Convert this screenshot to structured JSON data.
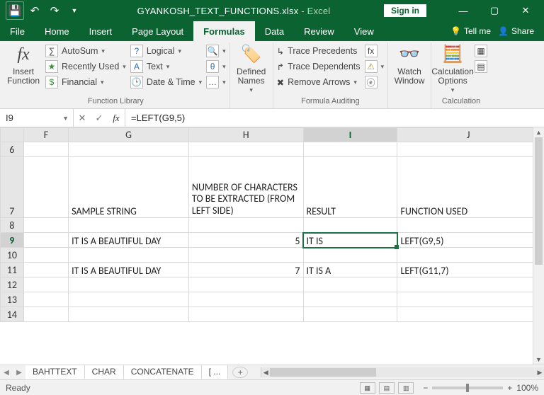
{
  "titlebar": {
    "doc": "GYANKOSH_TEXT_FUNCTIONS.xlsx",
    "app": "Excel",
    "signin": "Sign in"
  },
  "tabs": {
    "file": "File",
    "home": "Home",
    "insert": "Insert",
    "page_layout": "Page Layout",
    "formulas": "Formulas",
    "data": "Data",
    "review": "Review",
    "view": "View",
    "tellme": "Tell me",
    "share": "Share"
  },
  "ribbon": {
    "insert_function": "Insert Function",
    "autosum": "AutoSum",
    "recently_used": "Recently Used",
    "financial": "Financial",
    "logical": "Logical",
    "text": "Text",
    "date_time": "Date & Time",
    "defined_names": "Defined Names",
    "trace_prec": "Trace Precedents",
    "trace_dep": "Trace Dependents",
    "remove_arrows": "Remove Arrows",
    "watch_window": "Watch Window",
    "calc_options": "Calculation Options",
    "group_funclib": "Function Library",
    "group_audit": "Formula Auditing",
    "group_calc": "Calculation"
  },
  "formula_bar": {
    "cell_ref": "I9",
    "formula": "=LEFT(G9,5)"
  },
  "columns": [
    "F",
    "G",
    "H",
    "I",
    "J"
  ],
  "rows": [
    "6",
    "7",
    "8",
    "9",
    "10",
    "11",
    "12",
    "13",
    "14"
  ],
  "headers": {
    "G7": "SAMPLE STRING",
    "H7": "NUMBER OF CHARACTERS TO BE EXTRACTED (FROM LEFT SIDE)",
    "I7": "RESULT",
    "J7": "FUNCTION USED"
  },
  "cells": {
    "G9": "IT IS A BEAUTIFUL DAY",
    "H9": "5",
    "I9": "IT IS",
    "J9": "LEFT(G9,5)",
    "G11": "IT IS A BEAUTIFUL DAY",
    "H11": "7",
    "I11": "IT IS A",
    "J11": "LEFT(G11,7)"
  },
  "sheet_tabs": {
    "t1": "BAHTTEXT",
    "t2": "CHAR",
    "t3": "CONCATENATE",
    "more": "[ ..."
  },
  "status": {
    "ready": "Ready",
    "zoom": "100%"
  }
}
